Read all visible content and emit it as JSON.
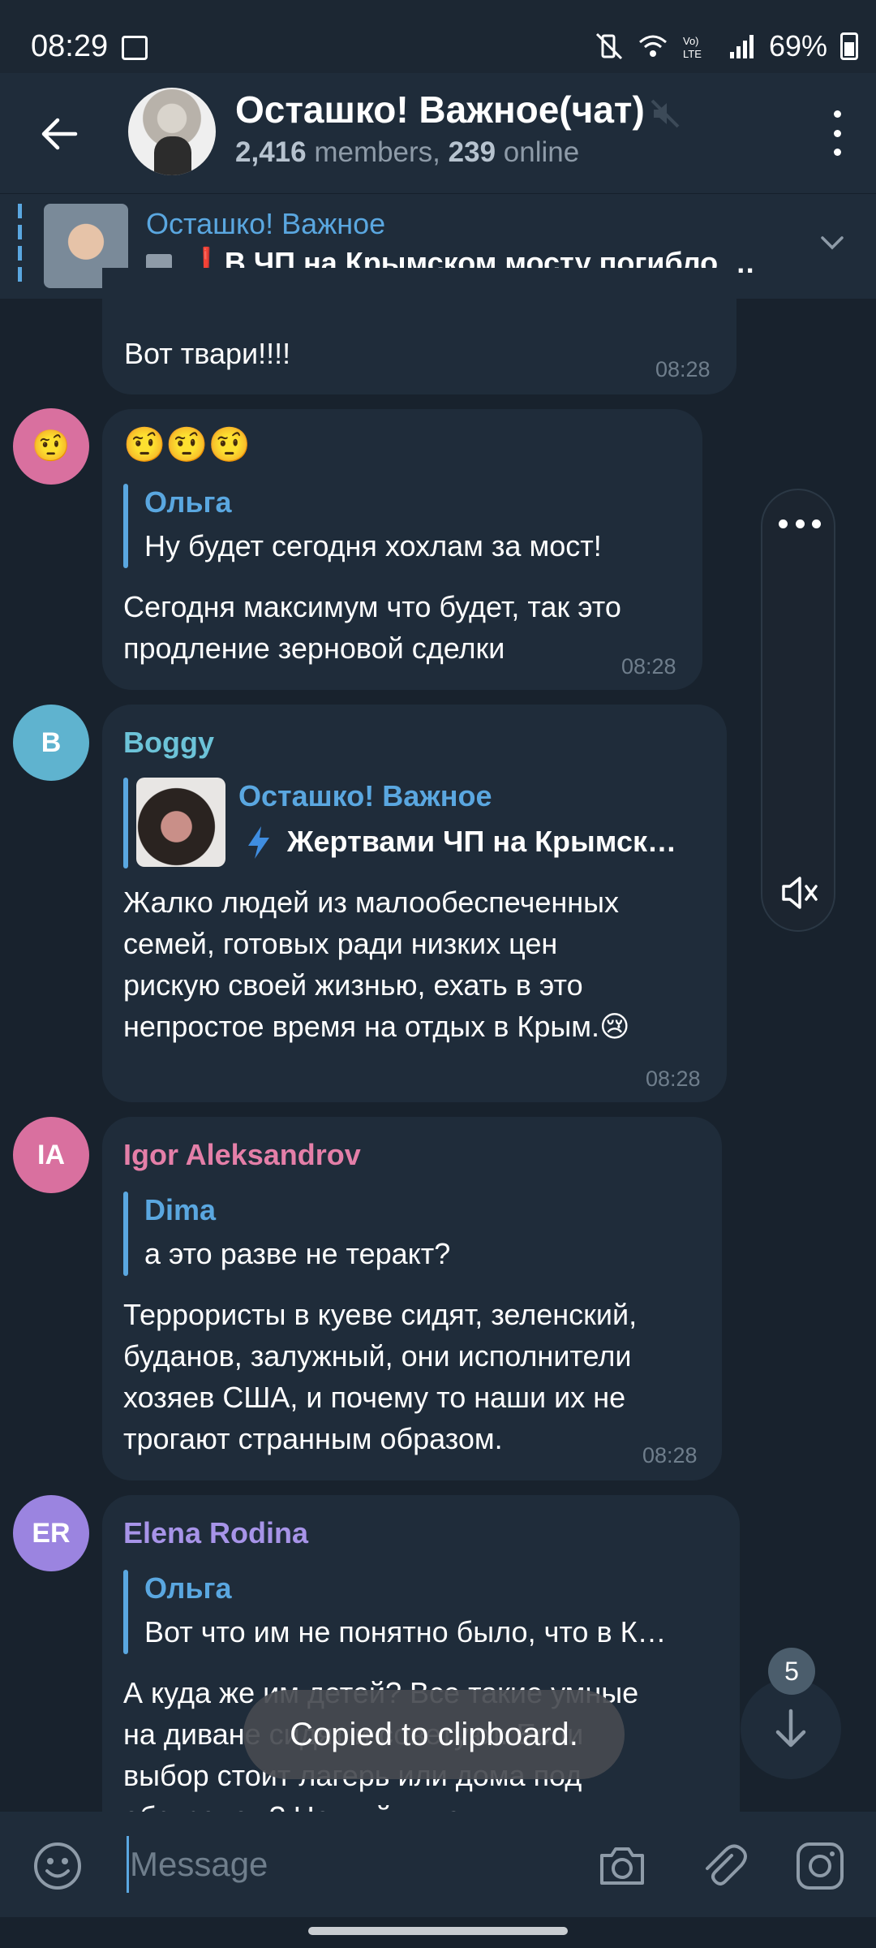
{
  "status_bar": {
    "time": "08:29",
    "battery": "69%"
  },
  "header": {
    "title": "Осташко! Важное(чат)",
    "members_count": "2,416",
    "members_label": " members, ",
    "online_count": "239",
    "online_label": " online"
  },
  "pinned": {
    "title": "Осташко! Важное",
    "text": "В ЧП на Крымском мосту погибло д…"
  },
  "messages": [
    {
      "text": "Вот твари!!!!",
      "time": "08:28"
    },
    {
      "avatar_emoji": "🤨",
      "emoji_line": "🤨🤨🤨",
      "reply_name": "Ольга",
      "reply_text": "Ну будет сегодня хохлам за мост!",
      "text_lines": [
        "Сегодня максимум что будет, так это",
        "продление зерновой сделки"
      ],
      "time": "08:28"
    },
    {
      "avatar_letter": "B",
      "sender": "Boggy",
      "reply_name": "Осташко! Важное",
      "reply_text": "Жертвами ЧП на Крымск…",
      "text_lines": [
        "Жалко людей из малообеспеченных",
        "семей, готовых ради низких цен",
        "рискую своей жизнью, ехать в это",
        "непростое время на отдых в Крым.😢"
      ],
      "time": "08:28"
    },
    {
      "avatar_letter": "IA",
      "sender": "Igor Aleksandrov",
      "reply_name": "Dima",
      "reply_text": "а это разве не теракт?",
      "text_lines": [
        "Террористы в куеве сидят, зеленский,",
        "буданов, залужный, они исполнители",
        "хозяев США, и почему то наши их не",
        "трогают странным образом."
      ],
      "time": "08:28"
    },
    {
      "avatar_letter": "ER",
      "sender": "Elena Rodina",
      "reply_name": "Ольга",
      "reply_text": "Вот что им не понятно было, что в К…",
      "text_lines": [
        "А куда же им детей? Все такие умные",
        "на диване сидят и советуют. Если",
        "выбор стоит лагерь или дома под",
        "обстрелом? Не выйти на улицу"
      ]
    }
  ],
  "unread_badge": "5",
  "toast": "Copied to clipboard.",
  "input": {
    "placeholder": "Message"
  },
  "colors": {
    "background": "#18222d",
    "bubble": "#1f2c3a",
    "accent": "#5aa7e0",
    "sender_boggy": "#6cc3d8",
    "sender_igor": "#e47fa8",
    "sender_elena": "#a794e8"
  }
}
